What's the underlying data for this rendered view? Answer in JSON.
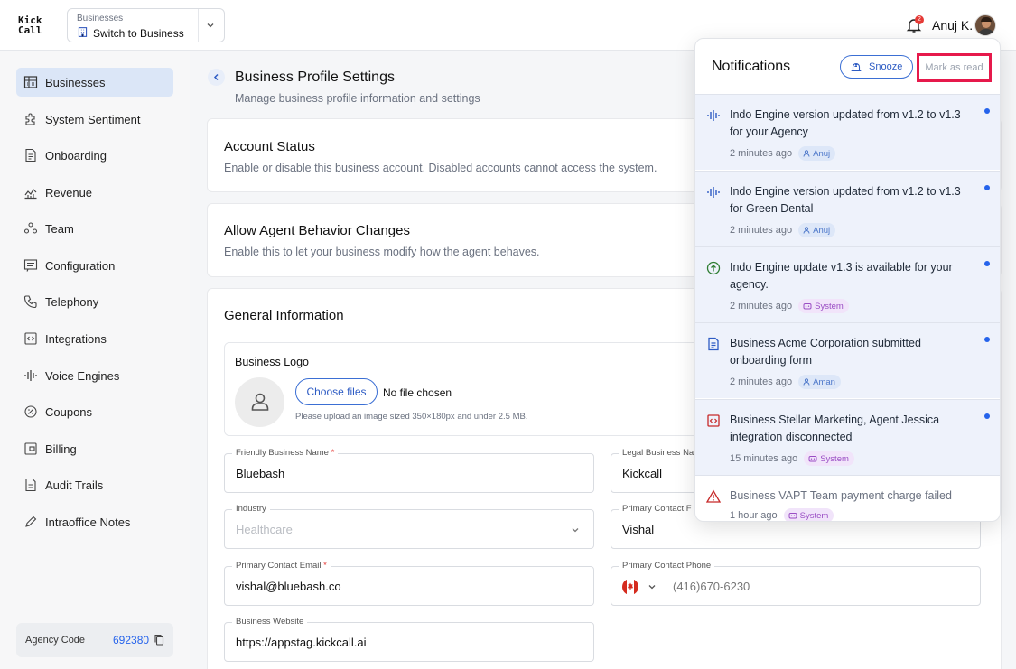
{
  "header": {
    "logo_line1": "Kick",
    "logo_line2": "Call",
    "switcher_caption": "Businesses",
    "switcher_value": "Switch to Business",
    "notification_count": "2",
    "user_name": "Anuj K."
  },
  "sidebar": {
    "items": [
      {
        "label": "Businesses",
        "icon": "building-icon"
      },
      {
        "label": "System Sentiment",
        "icon": "puzzle-icon"
      },
      {
        "label": "Onboarding",
        "icon": "document-icon"
      },
      {
        "label": "Revenue",
        "icon": "chart-icon"
      },
      {
        "label": "Team",
        "icon": "team-icon"
      },
      {
        "label": "Configuration",
        "icon": "message-icon"
      },
      {
        "label": "Telephony",
        "icon": "phone-icon"
      },
      {
        "label": "Integrations",
        "icon": "code-icon"
      },
      {
        "label": "Voice Engines",
        "icon": "waveform-icon"
      },
      {
        "label": "Coupons",
        "icon": "coupon-icon"
      },
      {
        "label": "Billing",
        "icon": "wallet-icon"
      },
      {
        "label": "Audit Trails",
        "icon": "file-icon"
      },
      {
        "label": "Intraoffice Notes",
        "icon": "pencil-icon"
      }
    ],
    "agency_label": "Agency Code",
    "agency_code": "692380"
  },
  "page": {
    "title": "Business Profile Settings",
    "subtitle": "Manage business profile information and settings"
  },
  "account_status": {
    "title": "Account Status",
    "description": "Enable or disable this business account. Disabled accounts cannot access the system."
  },
  "agent_behavior": {
    "title": "Allow Agent Behavior Changes",
    "description": "Enable this to let your business modify how the agent behaves."
  },
  "general": {
    "title": "General Information",
    "logo_title": "Business Logo",
    "choose_files": "Choose files",
    "no_file": "No file chosen",
    "upload_hint": "Please upload an image sized 350×180px and under 2.5 MB.",
    "friendly_name_label": "Friendly Business Name",
    "friendly_name_value": "Bluebash",
    "legal_name_label": "Legal Business Na",
    "legal_name_value": "Kickcall",
    "industry_label": "Industry",
    "industry_value": "Healthcare",
    "primary_contact_label": "Primary Contact F",
    "primary_contact_value": "Vishal",
    "email_label": "Primary Contact Email",
    "email_value": "vishal@bluebash.co",
    "phone_label": "Primary Contact Phone",
    "phone_value": "(416)670-6230",
    "website_label": "Business Website",
    "website_value": "https://appstag.kickcall.ai",
    "required_mark": "*"
  },
  "notifications": {
    "title": "Notifications",
    "snooze": "Snooze",
    "mark_as_read": "Mark as read",
    "items": [
      {
        "text": "Indo Engine version updated from v1.2 to v1.3 for your Agency",
        "time": "2 minutes ago",
        "tag": "Anuj",
        "tag_type": "user",
        "icon": "waveform-icon",
        "unread": true
      },
      {
        "text": "Indo Engine version updated from v1.2 to v1.3 for Green Dental",
        "time": "2 minutes ago",
        "tag": "Anuj",
        "tag_type": "user",
        "icon": "waveform-icon",
        "unread": true
      },
      {
        "text": "Indo Engine update v1.3 is available for your agency.",
        "time": "2 minutes ago",
        "tag": "System",
        "tag_type": "system",
        "icon": "arrow-up-circle-icon",
        "unread": true
      },
      {
        "text": "Business Acme Corporation submitted onboarding form",
        "time": "2 minutes ago",
        "tag": "Aman",
        "tag_type": "user",
        "icon": "document-icon",
        "unread": true
      },
      {
        "text": "Business Stellar Marketing, Agent Jessica integration disconnected",
        "time": "15 minutes ago",
        "tag": "System",
        "tag_type": "system",
        "icon": "disconnect-icon",
        "unread": true
      },
      {
        "text": "Business VAPT Team payment charge failed",
        "time": "1 hour ago",
        "tag": "System",
        "tag_type": "system",
        "icon": "warning-icon",
        "unread": false
      }
    ]
  },
  "colors": {
    "accent": "#2563eb",
    "highlight_box": "#e6194b",
    "unread_bg": "#eef2fb",
    "sidebar_active": "#dbe6f7"
  }
}
